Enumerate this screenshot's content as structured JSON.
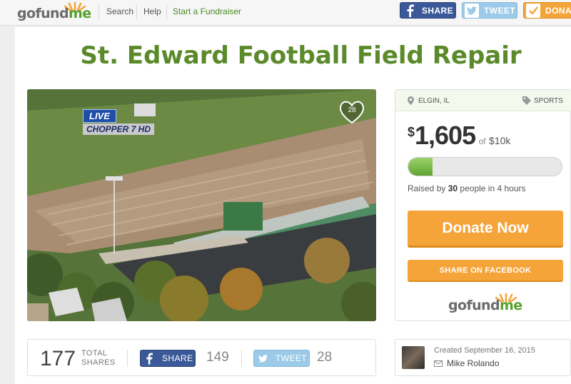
{
  "header": {
    "logo_parts": [
      "go",
      "fund",
      "me"
    ],
    "nav": [
      "Search",
      "Help",
      "Start a Fundraiser"
    ],
    "share_label": "SHARE",
    "tweet_label": "TWEET",
    "donate_label": "DONA"
  },
  "campaign": {
    "title": "St. Edward Football Field Repair",
    "photo_overlay": {
      "live": "LIVE",
      "channel": "CHOPPER 7 HD",
      "heart_count": "28"
    }
  },
  "card": {
    "location": "ELGIN, IL",
    "category": "SPORTS",
    "currency": "$",
    "raised": "1,605",
    "of_label": "of",
    "goal": "$10k",
    "progress_fraction": 0.16,
    "raised_by_prefix": "Raised by",
    "raised_people": "30",
    "raised_people_suffix": "people in",
    "raised_time": "4 hours",
    "donate_button": "Donate Now",
    "share_facebook_button": "SHARE ON FACEBOOK",
    "logo_parts": [
      "go",
      "fund",
      "me"
    ]
  },
  "share_stats": {
    "total": "177",
    "total_label_1": "TOTAL",
    "total_label_2": "SHARES",
    "facebook_label": "SHARE",
    "facebook_count": "149",
    "tweet_label": "TWEET",
    "tweet_count": "28"
  },
  "creator": {
    "created": "Created September 16, 2015",
    "name": "Mike Rolando"
  },
  "colors": {
    "brand_green": "#5a8a2a",
    "orange": "#f5a43a",
    "facebook_blue": "#3b5998",
    "twitter_blue": "#9bcbe8"
  }
}
